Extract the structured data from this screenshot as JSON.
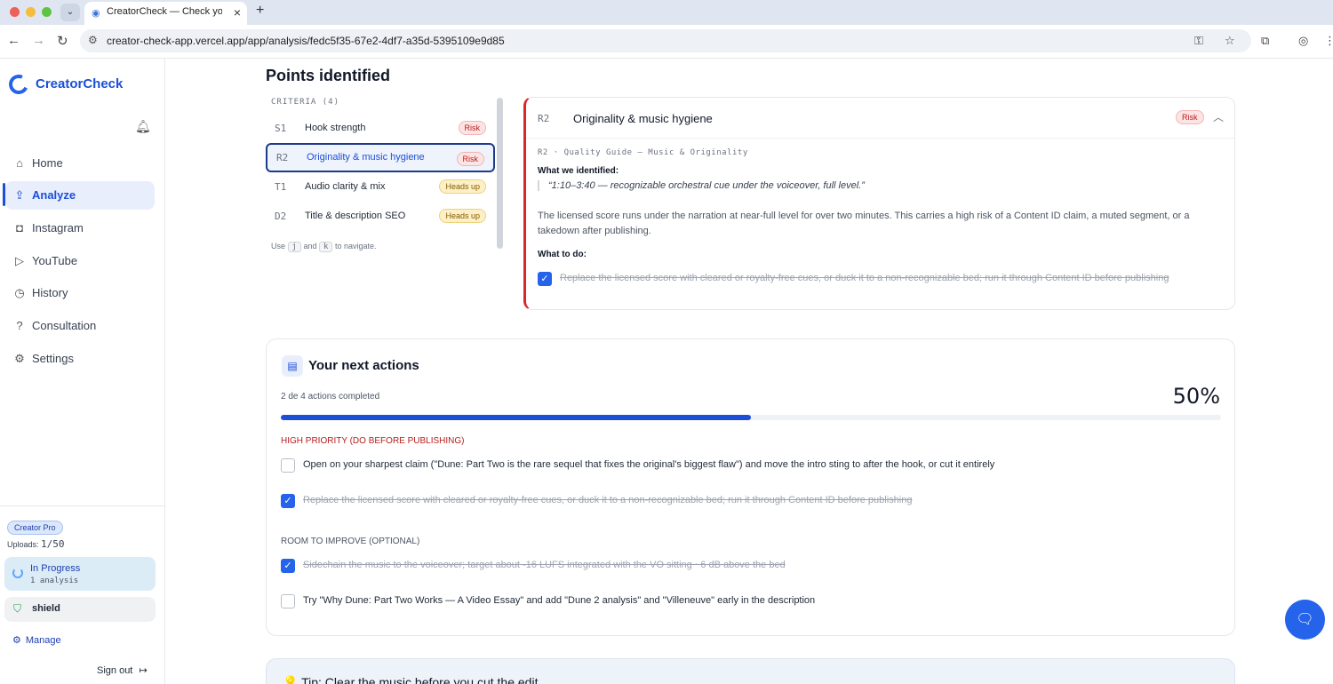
{
  "browser": {
    "tab_title": "CreatorCheck — Check your c",
    "url": "creator-check-app.vercel.app/app/analysis/fedc5f35-67e2-4df7-a35d-5395109e9d85"
  },
  "sidebar": {
    "brand": "CreatorCheck",
    "items": [
      {
        "label": "Home",
        "icon": "home-icon"
      },
      {
        "label": "Analyze",
        "icon": "upload-icon"
      },
      {
        "label": "Instagram",
        "icon": "instagram-icon"
      },
      {
        "label": "YouTube",
        "icon": "youtube-icon"
      },
      {
        "label": "History",
        "icon": "history-icon"
      },
      {
        "label": "Consultation",
        "icon": "help-icon"
      },
      {
        "label": "Settings",
        "icon": "gear-icon"
      }
    ],
    "active": "Analyze",
    "plan": "Creator Pro",
    "uploads_label": "Uploads:",
    "uploads_value": "1/50",
    "progress_title": "In Progress",
    "progress_sub": "1 analysis",
    "shield_label": "shield",
    "manage": "Manage",
    "signout": "Sign out"
  },
  "main": {
    "title": "Points identified",
    "criteria": {
      "header": "CRITERIA (4)",
      "items": [
        {
          "code": "S1",
          "name": "Hook strength",
          "badge": "Risk",
          "kind": "risk"
        },
        {
          "code": "R2",
          "name": "Originality & music hygiene",
          "badge": "Risk",
          "kind": "risk"
        },
        {
          "code": "T1",
          "name": "Audio clarity & mix",
          "badge": "Heads up",
          "kind": "heads"
        },
        {
          "code": "D2",
          "name": "Title & description SEO",
          "badge": "Heads up",
          "kind": "heads"
        }
      ],
      "hint_pre": "Use",
      "hint_key1": "j",
      "hint_and": "and",
      "hint_key2": "k",
      "hint_post": "to navigate."
    },
    "detail": {
      "code": "R2",
      "title": "Originality & music hygiene",
      "badge": "Risk",
      "guide": "R2 · Quality Guide — Music & Originality",
      "identified_label": "What we identified:",
      "quote": "“1:10–3:40 — recognizable orchestral cue under the voiceover, full level.”",
      "body": "The licensed score runs under the narration at near-full level for over two minutes. This carries a high risk of a Content ID claim, a muted segment, or a takedown after publishing.",
      "todo_label": "What to do:",
      "action": "Replace the licensed score with cleared or royalty-free cues, or duck it to a non-recognizable bed; run it through Content ID before publishing"
    },
    "actions": {
      "title": "Your next actions",
      "count": "2 de 4 actions completed",
      "percent": "50%",
      "progress": 0.5,
      "high_label": "HIGH PRIORITY (DO BEFORE PUBLISHING)",
      "high_tasks": [
        {
          "text": "Open on your sharpest claim (\"Dune: Part Two is the rare sequel that fixes the original's biggest flaw\") and move the intro sting to after the hook, or cut it entirely",
          "done": false
        },
        {
          "text": "Replace the licensed score with cleared or royalty-free cues, or duck it to a non-recognizable bed; run it through Content ID before publishing",
          "done": true
        }
      ],
      "room_label": "ROOM TO IMPROVE (OPTIONAL)",
      "room_tasks": [
        {
          "text": "Sidechain the music to the voiceover; target about -16 LUFS integrated with the VO sitting ~6 dB above the bed",
          "done": true
        },
        {
          "text": "Try \"Why Dune: Part Two Works — A Video Essay\" and add \"Dune 2 analysis\" and \"Villeneuve\" early in the description",
          "done": false
        }
      ]
    },
    "tip": "💡 Tip: Clear the music before you cut the edit"
  }
}
